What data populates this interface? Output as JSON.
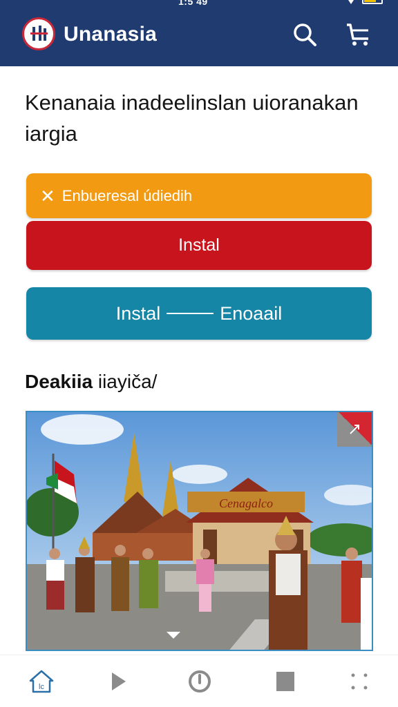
{
  "status_bar": {
    "time": "1:5 49"
  },
  "header": {
    "brand": "Unanasia",
    "logo_icon": "brand-logo-icon",
    "search_icon": "search-icon",
    "cart_icon": "cart-icon",
    "background": "#1f3b70"
  },
  "main": {
    "headline": "Kenanaia inadeelinslan uioranakan iargia",
    "buttons": {
      "orange": {
        "icon": "close-x-icon",
        "label": "Enbueresal údiedih",
        "color": "#f29b12"
      },
      "red": {
        "label": "Instal",
        "color": "#c8141c"
      },
      "teal": {
        "label_left": "Instal",
        "label_right": "Enoaail",
        "color": "#1686a6"
      }
    },
    "section_title_bold": "Deakiia",
    "section_title_rest": "iiayiča/",
    "photo": {
      "label": "Cenagalco",
      "corner_icon": "expand-icon"
    }
  },
  "bottom_nav": {
    "items": [
      "home-icon",
      "play-icon",
      "power-circle-icon",
      "stop-square-icon",
      "more-grid-icon"
    ],
    "accent": "#2a6fa8"
  }
}
